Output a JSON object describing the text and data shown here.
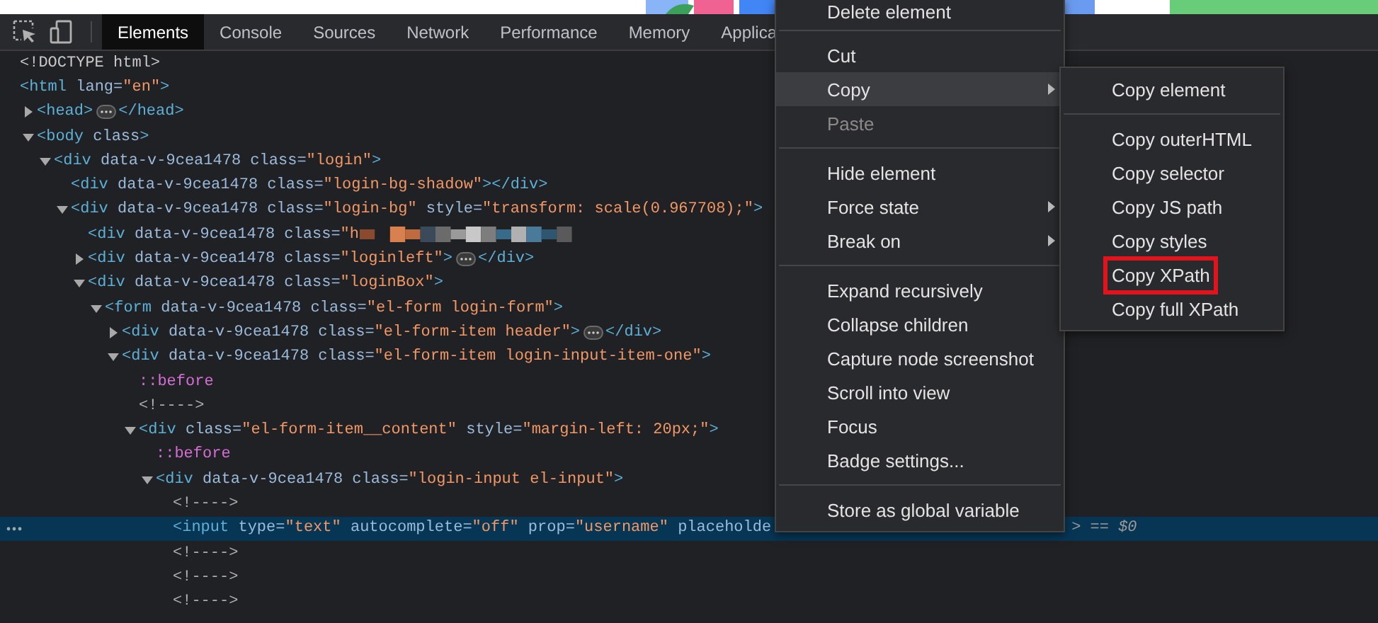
{
  "toolbar": {
    "tabs": [
      {
        "label": "Elements",
        "selected": true
      },
      {
        "label": "Console",
        "selected": false
      },
      {
        "label": "Sources",
        "selected": false
      },
      {
        "label": "Network",
        "selected": false
      },
      {
        "label": "Performance",
        "selected": false
      },
      {
        "label": "Memory",
        "selected": false
      },
      {
        "label": "Applica",
        "selected": false
      }
    ]
  },
  "dom_tree": [
    {
      "kind": "doctype",
      "markup": "<!DOCTYPE html>",
      "selected": false
    },
    {
      "kind": "element",
      "markup": "<html lang=\"en\">",
      "selected": false,
      "children": [
        {
          "kind": "element",
          "markup": "<head>",
          "close": "</head>",
          "expanded": false,
          "selected": false
        },
        {
          "kind": "element",
          "markup": "<body class>",
          "expanded": true,
          "selected": false,
          "children": [
            {
              "kind": "element",
              "markup": "<div data-v-9cea1478 class=\"login\">",
              "expanded": true,
              "selected": false,
              "children": [
                {
                  "kind": "element",
                  "markup": "<div data-v-9cea1478 class=\"login-bg-shadow\"></div>",
                  "selected": false
                },
                {
                  "kind": "element",
                  "markup": "<div data-v-9cea1478 class=\"login-bg\" style=\"transform: scale(0.967708);\">",
                  "expanded": true,
                  "selected": false,
                  "children": [
                    {
                      "kind": "blurred",
                      "markup": "<div data-v-9cea1478 class=\"h",
                      "selected": false
                    },
                    {
                      "kind": "element",
                      "markup": "<div data-v-9cea1478 class=\"loginleft\">",
                      "close": "</div>",
                      "expanded": false,
                      "selected": false
                    },
                    {
                      "kind": "element",
                      "markup": "<div data-v-9cea1478 class=\"loginBox\">",
                      "expanded": true,
                      "selected": false,
                      "children": [
                        {
                          "kind": "element",
                          "markup": "<form data-v-9cea1478 class=\"el-form login-form\">",
                          "expanded": true,
                          "selected": false,
                          "children": [
                            {
                              "kind": "element",
                              "markup": "<div data-v-9cea1478 class=\"el-form-item header\">",
                              "close": "</div>",
                              "expanded": false,
                              "selected": false
                            },
                            {
                              "kind": "element",
                              "markup": "<div data-v-9cea1478 class=\"el-form-item login-input-item-one\">",
                              "expanded": true,
                              "selected": false,
                              "children": [
                                {
                                  "kind": "pseudo",
                                  "markup": "::before",
                                  "selected": false
                                },
                                {
                                  "kind": "comment",
                                  "markup": "<!---->",
                                  "selected": false
                                },
                                {
                                  "kind": "element",
                                  "markup": "<div class=\"el-form-item__content\" style=\"margin-left: 20px;\">",
                                  "expanded": true,
                                  "selected": false,
                                  "children": [
                                    {
                                      "kind": "pseudo",
                                      "markup": "::before",
                                      "selected": false
                                    },
                                    {
                                      "kind": "element",
                                      "markup": "<div data-v-9cea1478 class=\"login-input el-input\">",
                                      "expanded": true,
                                      "selected": false,
                                      "children": [
                                        {
                                          "kind": "comment",
                                          "markup": "<!---->",
                                          "selected": false
                                        },
                                        {
                                          "kind": "element",
                                          "markup": "<input type=\"text\" autocomplete=\"off\" prop=\"username\" placeholde",
                                          "tail": "> == $0",
                                          "selected": true
                                        },
                                        {
                                          "kind": "comment",
                                          "markup": "<!---->",
                                          "selected": false
                                        },
                                        {
                                          "kind": "comment",
                                          "markup": "<!---->",
                                          "selected": false
                                        },
                                        {
                                          "kind": "comment",
                                          "markup": "<!---->",
                                          "selected": false
                                        }
                                      ]
                                    }
                                  ]
                                }
                              ]
                            }
                          ]
                        }
                      ]
                    }
                  ]
                }
              ]
            }
          ]
        }
      ]
    }
  ],
  "context_menu": {
    "items": [
      {
        "kind": "item",
        "label": "Delete element",
        "selected": false,
        "disabled": false,
        "submenu": false
      },
      {
        "kind": "separator"
      },
      {
        "kind": "item",
        "label": "Cut",
        "selected": false,
        "disabled": false,
        "submenu": false
      },
      {
        "kind": "item",
        "label": "Copy",
        "selected": true,
        "disabled": false,
        "submenu": true
      },
      {
        "kind": "item",
        "label": "Paste",
        "selected": false,
        "disabled": true,
        "submenu": false
      },
      {
        "kind": "separator"
      },
      {
        "kind": "item",
        "label": "Hide element",
        "selected": false,
        "disabled": false,
        "submenu": false
      },
      {
        "kind": "item",
        "label": "Force state",
        "selected": false,
        "disabled": false,
        "submenu": true
      },
      {
        "kind": "item",
        "label": "Break on",
        "selected": false,
        "disabled": false,
        "submenu": true
      },
      {
        "kind": "separator"
      },
      {
        "kind": "item",
        "label": "Expand recursively",
        "selected": false,
        "disabled": false,
        "submenu": false
      },
      {
        "kind": "item",
        "label": "Collapse children",
        "selected": false,
        "disabled": false,
        "submenu": false
      },
      {
        "kind": "item",
        "label": "Capture node screenshot",
        "selected": false,
        "disabled": false,
        "submenu": false
      },
      {
        "kind": "item",
        "label": "Scroll into view",
        "selected": false,
        "disabled": false,
        "submenu": false
      },
      {
        "kind": "item",
        "label": "Focus",
        "selected": false,
        "disabled": false,
        "submenu": false
      },
      {
        "kind": "item",
        "label": "Badge settings...",
        "selected": false,
        "disabled": false,
        "submenu": false
      },
      {
        "kind": "separator"
      },
      {
        "kind": "item",
        "label": "Store as global variable",
        "selected": false,
        "disabled": false,
        "submenu": false
      }
    ]
  },
  "copy_submenu": {
    "items": [
      {
        "kind": "item",
        "label": "Copy element",
        "highlighted": false
      },
      {
        "kind": "separator"
      },
      {
        "kind": "item",
        "label": "Copy outerHTML",
        "highlighted": false
      },
      {
        "kind": "item",
        "label": "Copy selector",
        "highlighted": false
      },
      {
        "kind": "item",
        "label": "Copy JS path",
        "highlighted": false
      },
      {
        "kind": "item",
        "label": "Copy styles",
        "highlighted": false
      },
      {
        "kind": "item",
        "label": "Copy XPath",
        "highlighted": true
      },
      {
        "kind": "item",
        "label": "Copy full XPath",
        "highlighted": false
      }
    ]
  }
}
